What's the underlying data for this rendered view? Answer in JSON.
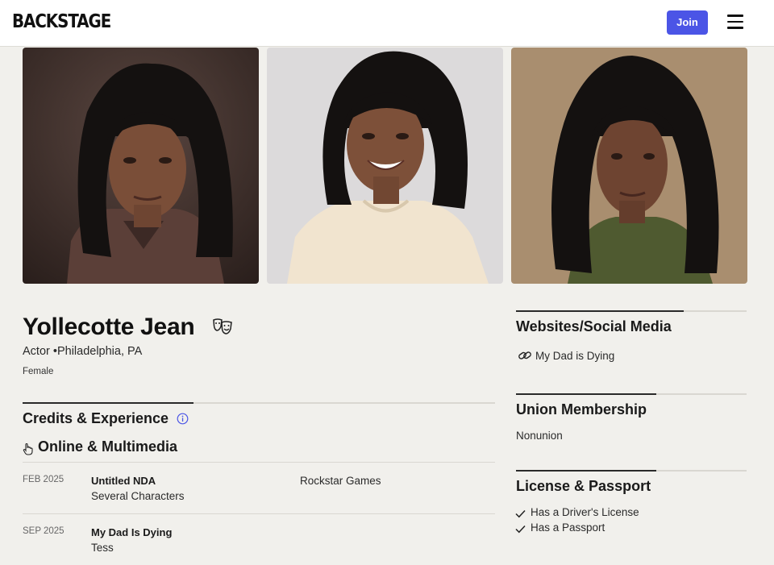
{
  "header": {
    "logo": "BACKSTAGE",
    "join_label": "Join",
    "menu_icon": "hamburger-menu-icon",
    "join_color": "#4b55e6"
  },
  "photos": [
    {
      "alt": "Headshot 1",
      "background": "#3d2e2a",
      "top_color": "brown-top"
    },
    {
      "alt": "Headshot 2",
      "background": "#d9d7d8",
      "top_color": "cream-top"
    },
    {
      "alt": "Headshot 3",
      "background": "#a88d6e",
      "top_color": "olive-top"
    }
  ],
  "profile": {
    "name": "Yollecotte Jean",
    "masks_icon": "theater-masks-icon",
    "role": "Actor",
    "separator": "•",
    "location": "Philadelphia, PA",
    "gender": "Female"
  },
  "credits": {
    "title": "Credits & Experience",
    "info_icon": "info-icon",
    "category_icon": "pointer-hand-icon",
    "category": "Online & Multimedia",
    "items": [
      {
        "date": "FEB 2025",
        "title": "Untitled NDA",
        "role": "Several Characters",
        "company": "Rockstar Games"
      },
      {
        "date": "SEP 2025",
        "title": "My Dad Is Dying",
        "role": "Tess",
        "company": ""
      }
    ]
  },
  "sidebar": {
    "websites": {
      "title": "Websites/Social Media",
      "link_icon": "link-icon",
      "link_label": "My Dad is Dying"
    },
    "union": {
      "title": "Union Membership",
      "value": "Nonunion"
    },
    "license": {
      "title": "License & Passport",
      "check_icon": "check-icon",
      "items": [
        "Has a Driver's License",
        "Has a Passport"
      ]
    }
  }
}
